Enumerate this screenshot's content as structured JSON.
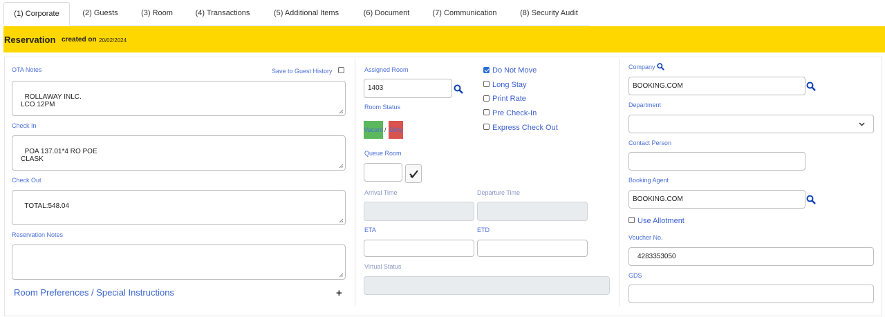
{
  "tabs": [
    {
      "label": "(1) Corporate"
    },
    {
      "label": "(2) Guests"
    },
    {
      "label": "(3) Room"
    },
    {
      "label": "(4) Transactions"
    },
    {
      "label": "(5) Additional Items"
    },
    {
      "label": "(6) Document"
    },
    {
      "label": "(7) Communication"
    },
    {
      "label": "(8) Security Audit"
    }
  ],
  "banner": {
    "title": "Reservation",
    "created_label": "created on",
    "date": "20/02/2024",
    "color": "#ffd700"
  },
  "left": {
    "ota_notes_label": "OTA Notes",
    "save_history_label": "Save to Guest History",
    "ota_notes_value": "ROLLAWAY INLC.\nLCO 12PM",
    "check_in_label": "Check In",
    "check_in_value": "POA 137.01*4 RO POE\nCLASK",
    "check_out_label": "Check Out",
    "check_out_value": "TOTAL:548.04",
    "res_notes_label": "Reservation Notes",
    "res_notes_value": "",
    "preferences_label": "Room Preferences / Special Instructions",
    "expand_symbol": "+"
  },
  "middle": {
    "assigned_room_label": "Assigned Room",
    "assigned_room_value": "1403",
    "room_status_label": "Room Status",
    "status_vacant": "Vacant",
    "status_sep": "/",
    "status_dirty": "Dirty",
    "vacant_color": "#5cb85c",
    "dirty_color": "#d9534f",
    "queue_room_label": "Queue Room",
    "queue_room_value": "",
    "arrival_label": "Arrival Time",
    "departure_label": "Departure Time",
    "eta_label": "ETA",
    "etd_label": "ETD",
    "virtual_status_label": "Virtual Status",
    "checks": [
      {
        "label": "Do Not Move",
        "checked": true
      },
      {
        "label": "Long Stay",
        "checked": false
      },
      {
        "label": "Print Rate",
        "checked": false
      },
      {
        "label": "Pre Check-In",
        "checked": false
      },
      {
        "label": "Express Check Out",
        "checked": false
      }
    ]
  },
  "right": {
    "company_label": "Company",
    "company_value": "BOOKING.COM",
    "department_label": "Department",
    "department_value": "",
    "contact_label": "Contact Person",
    "contact_value": "",
    "agent_label": "Booking Agent",
    "agent_value": "BOOKING.COM",
    "allotment_label": "Use Allotment",
    "voucher_label": "Voucher No.",
    "voucher_value": "4283353050",
    "gds_label": "GDS",
    "gds_value": ""
  }
}
